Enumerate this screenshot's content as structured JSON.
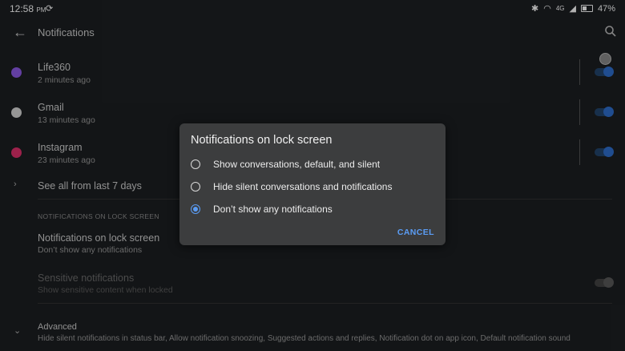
{
  "status_bar": {
    "time": "12:58",
    "ampm": "PM",
    "network": "4G",
    "battery": "47%"
  },
  "header": {
    "title": "Notifications"
  },
  "apps": [
    {
      "name": "Life360",
      "time": "2 minutes ago",
      "icon_color": "#8e5be8"
    },
    {
      "name": "Gmail",
      "time": "13 minutes ago",
      "icon_color": "#d7d7d7"
    },
    {
      "name": "Instagram",
      "time": "23 minutes ago",
      "icon_color": "#e1306c"
    }
  ],
  "see_all": "See all from last 7 days",
  "lock_section": {
    "header": "NOTIFICATIONS ON LOCK SCREEN",
    "item_title": "Notifications on lock screen",
    "item_value": "Don’t show any notifications"
  },
  "sensitive": {
    "title": "Sensitive notifications",
    "subtitle": "Show sensitive content when locked"
  },
  "advanced": {
    "title": "Advanced",
    "subtitle": "Hide silent notifications in status bar, Allow notification snoozing, Suggested actions and replies, Notification dot on app icon, Default notification sound"
  },
  "dialog": {
    "title": "Notifications on lock screen",
    "options": [
      "Show conversations, default, and silent",
      "Hide silent conversations and notifications",
      "Don’t show any notifications"
    ],
    "selected_index": 2,
    "cancel": "CANCEL"
  },
  "colors": {
    "accent": "#5b9df5",
    "background": "#1c1f22",
    "dialog": "#3c3d3e"
  }
}
